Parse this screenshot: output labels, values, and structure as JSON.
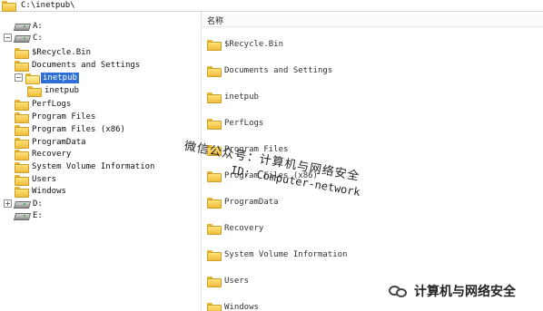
{
  "path": "C:\\inetpub\\",
  "list_header": "名称",
  "tree": [
    {
      "label": "A:",
      "icon": "drive-icon",
      "expander": "",
      "indent": 0
    },
    {
      "label": "C:",
      "icon": "drive-icon",
      "expander": "−",
      "indent": 0
    },
    {
      "label": "$Recycle.Bin",
      "icon": "folder-icon",
      "expander": "",
      "indent": 1
    },
    {
      "label": "Documents and Settings",
      "icon": "folder-icon",
      "expander": "",
      "indent": 1
    },
    {
      "label": "inetpub",
      "icon": "folder-open-icon",
      "expander": "−",
      "indent": 1,
      "selected": true
    },
    {
      "label": "inetpub",
      "icon": "folder-icon",
      "expander": "",
      "indent": 2
    },
    {
      "label": "PerfLogs",
      "icon": "folder-icon",
      "expander": "",
      "indent": 1
    },
    {
      "label": "Program Files",
      "icon": "folder-icon",
      "expander": "",
      "indent": 1
    },
    {
      "label": "Program Files (x86)",
      "icon": "folder-icon",
      "expander": "",
      "indent": 1
    },
    {
      "label": "ProgramData",
      "icon": "folder-icon",
      "expander": "",
      "indent": 1
    },
    {
      "label": "Recovery",
      "icon": "folder-icon",
      "expander": "",
      "indent": 1
    },
    {
      "label": "System Volume Information",
      "icon": "folder-icon",
      "expander": "",
      "indent": 1
    },
    {
      "label": "Users",
      "icon": "folder-icon",
      "expander": "",
      "indent": 1
    },
    {
      "label": "Windows",
      "icon": "folder-icon",
      "expander": "",
      "indent": 1
    },
    {
      "label": "D:",
      "icon": "drive-icon",
      "expander": "+",
      "indent": 0
    },
    {
      "label": "E:",
      "icon": "drive-icon",
      "expander": "",
      "indent": 0
    }
  ],
  "list_items": [
    "$Recycle.Bin",
    "Documents and Settings",
    "inetpub",
    "PerfLogs",
    "Program Files",
    "Program Files (x86)",
    "ProgramData",
    "Recovery",
    "System Volume Information",
    "Users",
    "Windows"
  ],
  "watermark": {
    "line1": "微信公众号：计算机与网络安全",
    "line2": "ID: Computer-network",
    "brand": "计算机与网络安全"
  }
}
